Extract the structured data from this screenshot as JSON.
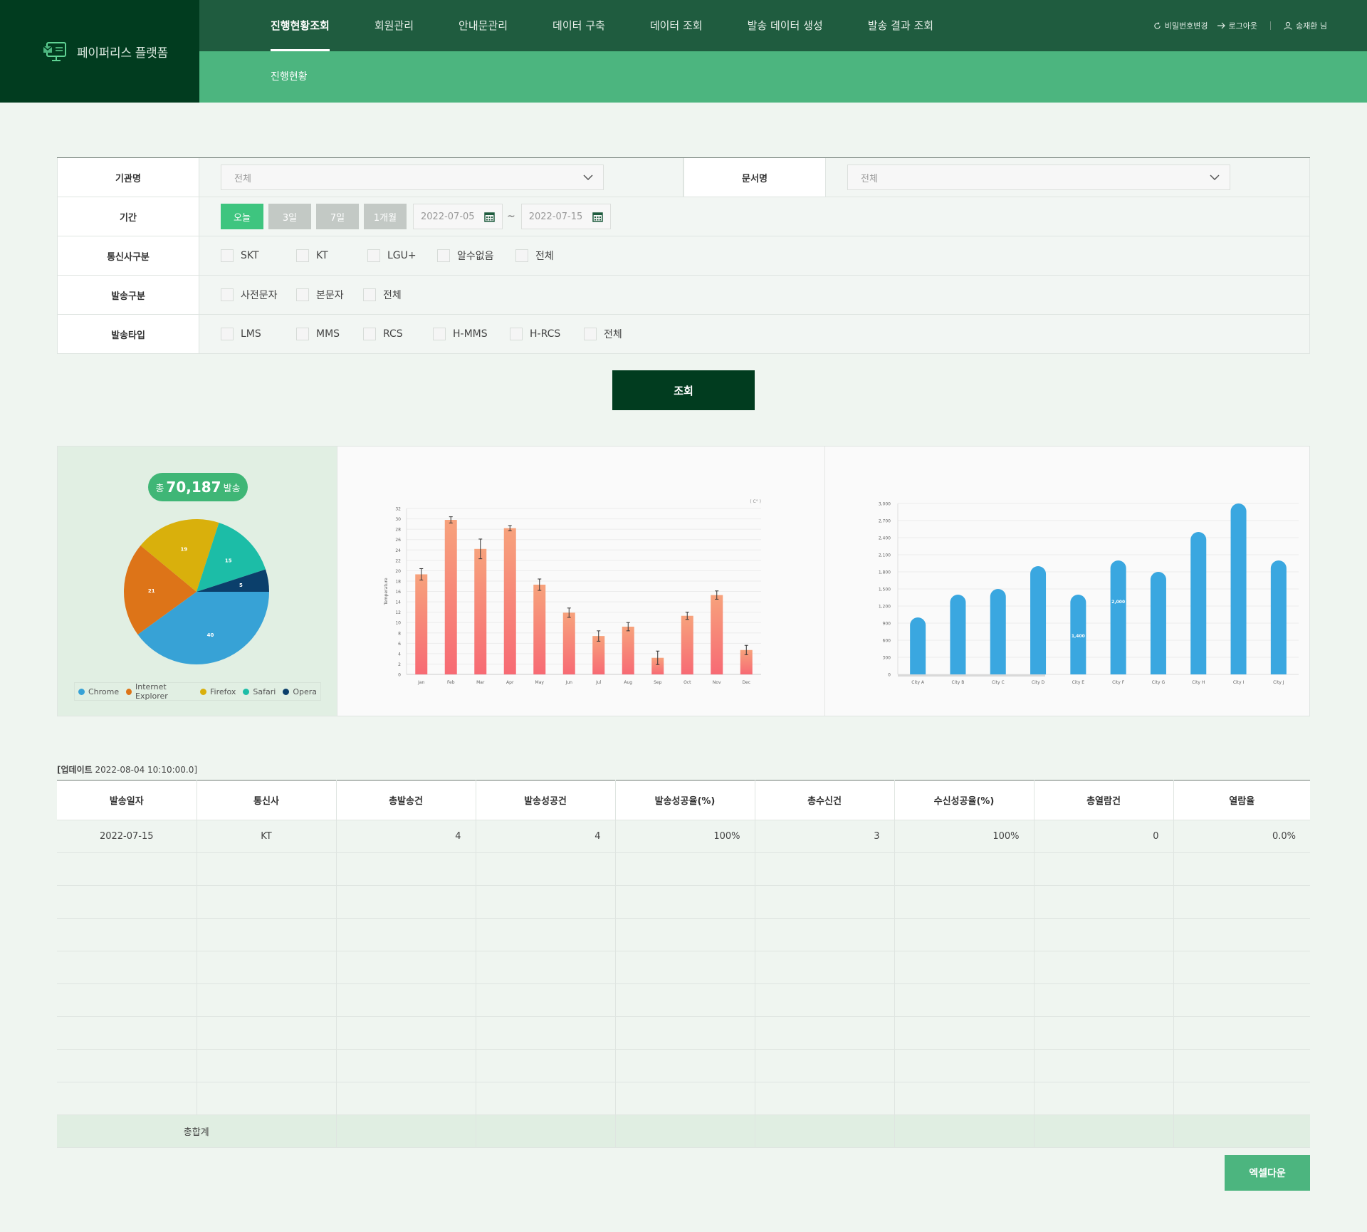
{
  "app": {
    "name": "페이퍼리스 플랫폼"
  },
  "nav": {
    "items": [
      "진행현황조회",
      "회원관리",
      "안내문관리",
      "데이터 구축",
      "데이터 조회",
      "발송 데이터 생성",
      "발송 결과 조회"
    ],
    "active_index": 0,
    "sub_item": "진행현황"
  },
  "util": {
    "password": "비밀번호변경",
    "logout": "로그아웃",
    "user": "송재환 님"
  },
  "form": {
    "org_label": "기관명",
    "org_value": "전체",
    "doc_label": "문서명",
    "doc_value": "전체",
    "period_label": "기간",
    "period_buttons": [
      "오늘",
      "3일",
      "7일",
      "1개월"
    ],
    "date_from": "2022-07-05",
    "date_to": "2022-07-15",
    "date_sep": "~",
    "carrier_label": "통신사구분",
    "carrier_options": [
      "SKT",
      "KT",
      "LGU+",
      "알수없음",
      "전체"
    ],
    "send_label": "발송구분",
    "send_options": [
      "사전문자",
      "본문자",
      "전체"
    ],
    "type_label": "발송타입",
    "type_options": [
      "LMS",
      "MMS",
      "RCS",
      "H-MMS",
      "H-RCS",
      "전체"
    ],
    "search_button": "조회"
  },
  "summary": {
    "prefix": "총",
    "total": "70,187",
    "suffix": "발송"
  },
  "chart_data": [
    {
      "type": "pie",
      "categories": [
        "Chrome",
        "Internet Explorer",
        "Firefox",
        "Safari",
        "Opera"
      ],
      "values": [
        40,
        21,
        19,
        15,
        5
      ],
      "colors": [
        "#37a2d6",
        "#dd7418",
        "#d9b00c",
        "#1cbda7",
        "#0b3f6b"
      ]
    },
    {
      "type": "bar",
      "categories": [
        "Jan",
        "Feb",
        "Mar",
        "Apr",
        "May",
        "Jun",
        "Jul",
        "Aug",
        "Sep",
        "Oct",
        "Nov",
        "Dec"
      ],
      "values": [
        19.3,
        29.8,
        24.2,
        28.2,
        17.3,
        11.9,
        7.4,
        9.2,
        3.2,
        11.3,
        15.3,
        4.7
      ],
      "errors": [
        1.1,
        0.6,
        1.9,
        0.5,
        1.1,
        0.9,
        1.0,
        0.8,
        1.3,
        0.7,
        0.8,
        0.9
      ],
      "ylabel": "Temperature",
      "unit_label": "( C° )",
      "ylim": [
        0,
        32
      ],
      "yticks": [
        0,
        2,
        4,
        6,
        8,
        10,
        12,
        14,
        16,
        18,
        20,
        22,
        24,
        26,
        28,
        30,
        32
      ],
      "color_top": "#f7a27c",
      "color_bottom": "#f76a74"
    },
    {
      "type": "bar",
      "categories": [
        "City A",
        "City B",
        "City C",
        "City D",
        "City E",
        "City F",
        "City G",
        "City H",
        "City I",
        "City J"
      ],
      "values": [
        1000,
        1400,
        1500,
        1900,
        1400,
        2000,
        1800,
        2500,
        3000,
        2000
      ],
      "data_labels": {
        "4": "1,400",
        "5": "2,000"
      },
      "ylim": [
        0,
        3000
      ],
      "yticks": [
        "0",
        "300",
        "600",
        "900",
        "1,200",
        "1,500",
        "1,800",
        "2,100",
        "2,400",
        "2,700",
        "3,000"
      ],
      "color": "#3aa7e0"
    }
  ],
  "table": {
    "updated_label": "[업데이트",
    "updated_value": "2022-08-04 10:10:00.0]",
    "headers": [
      "발송일자",
      "통신사",
      "총발송건",
      "발송성공건",
      "발송성공율(%)",
      "총수신건",
      "수신성공율(%)",
      "총열람건",
      "열람율"
    ],
    "rows": [
      [
        "2022-07-15",
        "KT",
        "4",
        "4",
        "100%",
        "3",
        "100%",
        "0",
        "0.0%"
      ]
    ],
    "total_label": "총합계",
    "excel_button": "엑셀다운"
  }
}
